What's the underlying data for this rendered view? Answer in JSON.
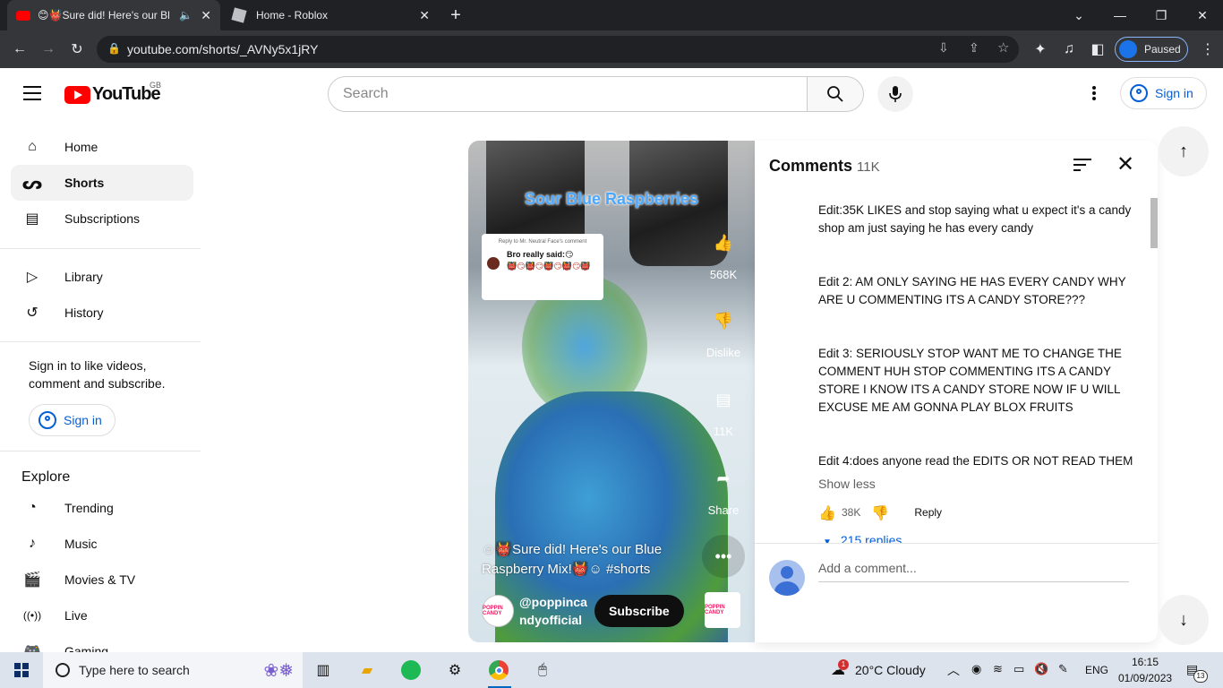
{
  "browser": {
    "tabs": [
      {
        "title": "😊👹Sure did! Here's our Bl",
        "active": true
      },
      {
        "title": "Home - Roblox",
        "active": false
      }
    ],
    "url": "youtube.com/shorts/_AVNy5x1jRY",
    "profile_status": "Paused"
  },
  "masthead": {
    "logo_text": "YouTube",
    "country_code": "GB",
    "search_placeholder": "Search",
    "signin_label": "Sign in"
  },
  "sidebar": {
    "items_top": [
      {
        "label": "Home",
        "icon": "home-icon"
      },
      {
        "label": "Shorts",
        "icon": "shorts-icon",
        "active": true
      },
      {
        "label": "Subscriptions",
        "icon": "subscriptions-icon"
      }
    ],
    "items_mid": [
      {
        "label": "Library",
        "icon": "library-icon"
      },
      {
        "label": "History",
        "icon": "history-icon"
      }
    ],
    "signin_message": "Sign in to like videos, comment and subscribe.",
    "signin_label": "Sign in",
    "explore_heading": "Explore",
    "explore_items": [
      {
        "label": "Trending",
        "icon": "trending-icon"
      },
      {
        "label": "Music",
        "icon": "music-icon"
      },
      {
        "label": "Movies & TV",
        "icon": "movies-icon"
      },
      {
        "label": "Live",
        "icon": "live-icon"
      },
      {
        "label": "Gaming",
        "icon": "gaming-icon"
      }
    ]
  },
  "video": {
    "overlay_title": "Sour Blue Raspberries",
    "reply_card": {
      "caption": "Reply to Mr. Neutral Face's comment",
      "text": "Bro really said:😏",
      "emojis": "👹😏👹😏👹😏👹😏👹"
    },
    "actions": {
      "like_count": "568K",
      "dislike_label": "Dislike",
      "comments_count": "11K",
      "share_label": "Share"
    },
    "description": "☺👹Sure did! Here's our Blue Raspberry Mix!👹☺ #shorts",
    "channel_name": "@poppincandyofficial",
    "channel_avatar_text": "POPPIN CANDY",
    "subscribe_label": "Subscribe"
  },
  "comments": {
    "heading": "Comments",
    "count": "11K",
    "paragraphs": [
      "Edit:35K LIKES and stop saying what u expect it's a candy shop am just saying he has every candy",
      "Edit 2: AM ONLY SAYING HE HAS EVERY CANDY WHY ARE U COMMENTING ITS A CANDY STORE???",
      "Edit 3: SERIOUSLY STOP WANT ME TO CHANGE THE COMMENT HUH STOP COMMENTING ITS A CANDY STORE I KNOW ITS A CANDY STORE NOW IF U WILL EXCUSE ME AM GONNA PLAY BLOX FRUITS",
      "Edit 4:does anyone read the EDITS OR NOT READ THEM"
    ],
    "show_less": "Show less",
    "like_count": "38K",
    "reply_label": "Reply",
    "replies_label": "215 replies",
    "add_comment_placeholder": "Add a comment..."
  },
  "taskbar": {
    "search_placeholder": "Type here to search",
    "weather": "20°C  Cloudy",
    "weather_badge": "1",
    "language": "ENG",
    "time": "16:15",
    "date": "01/09/2023",
    "notifications": "13"
  }
}
